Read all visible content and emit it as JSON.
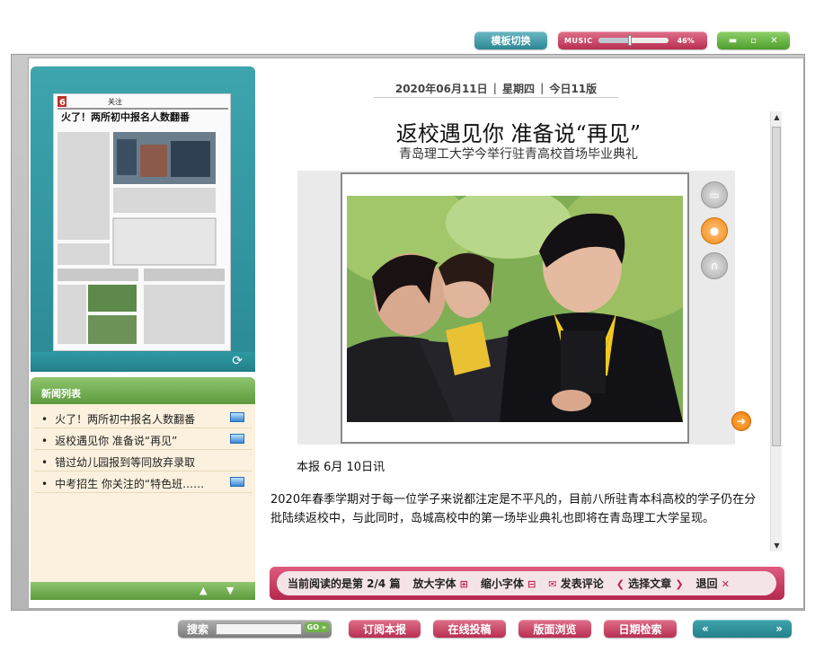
{
  "top_controls": {
    "template_switch": "模板切换",
    "music_label": "MUSIC",
    "music_volume": 0.46,
    "music_volume_label": "46%",
    "window_buttons": [
      "▬",
      "▫",
      "✕"
    ]
  },
  "thumbnail": {
    "page_number": "6",
    "section": "关注",
    "headline": "火了！两所初中报名人数翻番",
    "refresh_icon": "refresh-icon"
  },
  "news_list": {
    "header": "新闻列表",
    "items": [
      {
        "title": "火了！两所初中报名人数翻番"
      },
      {
        "title": "返校遇见你  准备说“再见”"
      },
      {
        "title": "错过幼儿园报到等同放弃录取"
      },
      {
        "title": "中考招生  你关注的“特色班……"
      }
    ]
  },
  "date_line": {
    "date": "2020年06月11日",
    "weekday": "星期四",
    "edition": "今日11版"
  },
  "article": {
    "title": "返校遇见你  准备说“再见”",
    "subtitle": "青岛理工大学今举行驻青高校首场毕业典礼",
    "byline": "本报  6月  10日讯",
    "body": "2020年春季学期对于每一位学子来说都注定是不平凡的，目前八所驻青本科高校的学子仍在分批陆续返校中，与此同时，岛城高校中的第一场毕业典礼也即将在青岛理工大学呈现。"
  },
  "read_toolbar": {
    "current_reading": "当前阅读的是第  2/4  篇",
    "enlarge_font": "放大字体",
    "shrink_font": "缩小字体",
    "comment": "发表评论",
    "select_article": "选择文章",
    "back": "退回"
  },
  "bottom_bar": {
    "search_label": "搜索",
    "search_go": "GO »",
    "subscribe": "订阅本报",
    "submit": "在线投稿",
    "layout_browse": "版面浏览",
    "date_search": "日期检索",
    "prev": "«",
    "next": "»"
  },
  "colors": {
    "teal": "#2a8a95",
    "pink": "#b82f52",
    "green": "#5d9a3c",
    "orange": "#ee7a06"
  }
}
